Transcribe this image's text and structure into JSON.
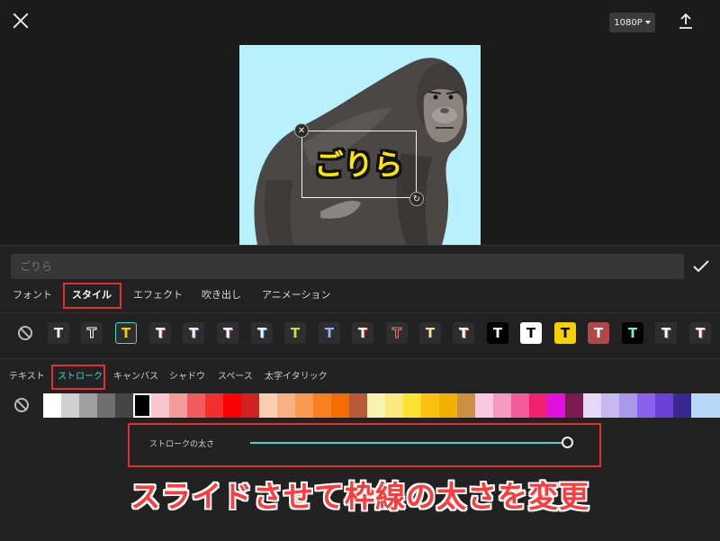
{
  "toolbar": {
    "resolution_label": "1080P"
  },
  "preview": {
    "caption": "ごりら"
  },
  "editor": {
    "text_placeholder": "ごりら"
  },
  "tabs": [
    {
      "label": "フォント"
    },
    {
      "label": "スタイル",
      "active": true
    },
    {
      "label": "エフェクト"
    },
    {
      "label": "吹き出し"
    },
    {
      "label": "アニメーション"
    }
  ],
  "style_presets": [
    {
      "glyph": "T",
      "icon": "none-icon"
    },
    {
      "glyph": "T"
    },
    {
      "glyph": "T"
    },
    {
      "glyph": "T"
    },
    {
      "glyph": "T"
    },
    {
      "glyph": "T"
    },
    {
      "glyph": "T"
    },
    {
      "glyph": "T"
    },
    {
      "glyph": "T"
    },
    {
      "glyph": "T"
    },
    {
      "glyph": "T"
    },
    {
      "glyph": "T"
    },
    {
      "glyph": "T"
    },
    {
      "glyph": "T"
    },
    {
      "glyph": "T"
    },
    {
      "glyph": "T"
    },
    {
      "glyph": "T"
    },
    {
      "glyph": "T"
    },
    {
      "glyph": "T"
    },
    {
      "glyph": "T"
    },
    {
      "glyph": "T"
    }
  ],
  "subtabs": [
    {
      "label": "テキスト"
    },
    {
      "label": "ストローク",
      "active": true
    },
    {
      "label": "キャンバス"
    },
    {
      "label": "シャドウ"
    },
    {
      "label": "スペース"
    },
    {
      "label": "太字イタリック"
    }
  ],
  "stroke_colors": [
    "#ffffff",
    "#d0d0d0",
    "#a0a0a0",
    "#6e6e6e",
    "#444444",
    "#000000",
    "#f7c6cf",
    "#f49a9a",
    "#f25c5c",
    "#f23030",
    "#ff0000",
    "#d42020",
    "#f8cdb0",
    "#f9b183",
    "#f89a50",
    "#f68020",
    "#f26c00",
    "#b85a38",
    "#fbf1b0",
    "#fbe880",
    "#fde030",
    "#fcc010",
    "#f2b000",
    "#c89040",
    "#f8c8e0",
    "#f49ac0",
    "#f25c9a",
    "#f02070",
    "#e010e0",
    "#7a1a50",
    "#e8d8f8",
    "#c8b8f0",
    "#a898e8",
    "#8a60f0",
    "#6a40d8",
    "#3a2890",
    "#b8d8f8"
  ],
  "stroke_width": {
    "label": "ストロークの太さ",
    "value": 1.0
  },
  "annotation": "スライドさせて枠線の太さを変更",
  "accent": "#4fd1c5",
  "highlight": "#e03030"
}
